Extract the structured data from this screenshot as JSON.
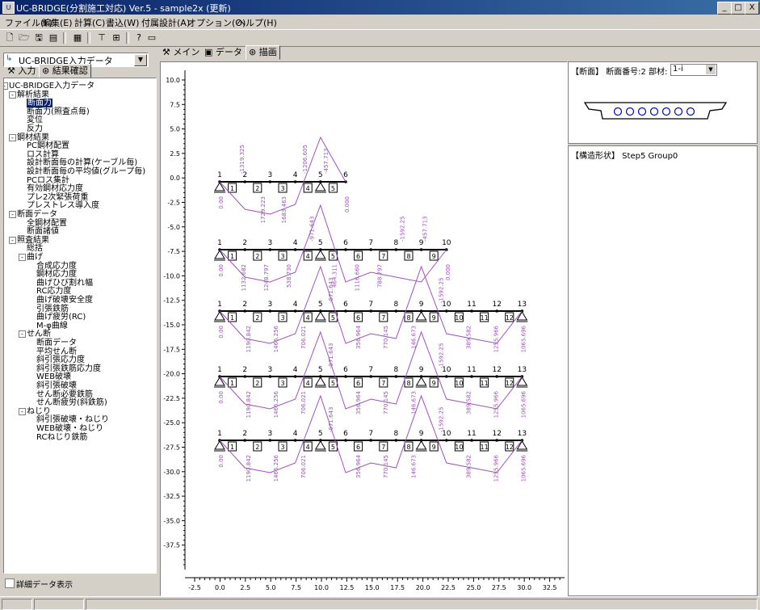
{
  "window": {
    "title": "UC-BRIDGE(分割施工対応) Ver.5 - sample2x (更新)",
    "buttons": [
      "_",
      "□",
      "X"
    ]
  },
  "menu": [
    "ファイル(F)",
    "編集(E)",
    "計算(C)",
    "書込(W)",
    "付属設計(A)",
    "オプション(O)",
    "ヘルプ(H)"
  ],
  "toolbar": [
    "new-icon",
    "open-icon",
    "save-icon",
    "print-icon",
    "calc-icon",
    "tool1-icon",
    "tool2-icon",
    "help-icon",
    "info-icon"
  ],
  "left": {
    "combo_value": "UC-BRIDGE入力データ",
    "tab_input": "入力",
    "tab_result": "結果確認",
    "checkbox_label": "詳細データ表示",
    "tree": [
      {
        "label": "UC-BRIDGE入力データ",
        "level": 0,
        "box": "-"
      },
      {
        "label": "解析結果",
        "level": 1,
        "box": "-"
      },
      {
        "label": "断面力",
        "level": 2,
        "selected": true
      },
      {
        "label": "断面力(照査点毎)",
        "level": 2
      },
      {
        "label": "変位",
        "level": 2
      },
      {
        "label": "反力",
        "level": 2
      },
      {
        "label": "鋼材結果",
        "level": 1,
        "box": "-"
      },
      {
        "label": "PC鋼材配置",
        "level": 2
      },
      {
        "label": "ロス計算",
        "level": 2
      },
      {
        "label": "設計断面毎の計算(ケーブル毎)",
        "level": 2
      },
      {
        "label": "設計断面毎の平均値(グループ毎)",
        "level": 2
      },
      {
        "label": "PCロス集計",
        "level": 2
      },
      {
        "label": "有効鋼材応力度",
        "level": 2
      },
      {
        "label": "プレ2次緊張荷重",
        "level": 2
      },
      {
        "label": "プレストレス導入度",
        "level": 2
      },
      {
        "label": "断面データ",
        "level": 1,
        "box": "-"
      },
      {
        "label": "全鋼材配置",
        "level": 2
      },
      {
        "label": "断面諸値",
        "level": 2
      },
      {
        "label": "照査結果",
        "level": 1,
        "box": "-"
      },
      {
        "label": "総括",
        "level": 2
      },
      {
        "label": "曲げ",
        "level": 2,
        "box": "-"
      },
      {
        "label": "合成応力度",
        "level": 3
      },
      {
        "label": "鋼材応力度",
        "level": 3
      },
      {
        "label": "曲げひび割れ幅",
        "level": 3
      },
      {
        "label": "RC応力度",
        "level": 3
      },
      {
        "label": "曲げ破壊安全度",
        "level": 3
      },
      {
        "label": "引張鉄筋",
        "level": 3
      },
      {
        "label": "曲げ疲労(RC)",
        "level": 3
      },
      {
        "label": "M-φ曲線",
        "level": 3
      },
      {
        "label": "せん断",
        "level": 2,
        "box": "-"
      },
      {
        "label": "断面データ",
        "level": 3
      },
      {
        "label": "平均せん断",
        "level": 3
      },
      {
        "label": "斜引張応力度",
        "level": 3
      },
      {
        "label": "斜引張鉄筋応力度",
        "level": 3
      },
      {
        "label": "WEB破壊",
        "level": 3
      },
      {
        "label": "斜引張破壊",
        "level": 3
      },
      {
        "label": "せん断必要鉄筋",
        "level": 3
      },
      {
        "label": "せん断疲労(斜鉄筋)",
        "level": 3
      },
      {
        "label": "ねじり",
        "level": 2,
        "box": "-"
      },
      {
        "label": "斜引張破壊・ねじり",
        "level": 3
      },
      {
        "label": "WEB破壊・ねじり",
        "level": 3
      },
      {
        "label": "RCねじり鉄筋",
        "level": 3
      }
    ]
  },
  "center": {
    "tabs": [
      "メイン",
      "データ",
      "描画"
    ],
    "active_tab": 2,
    "y_ticks": [
      "10.0",
      "7.5",
      "5.0",
      "2.5",
      "0.0",
      "-2.5",
      "-5.0",
      "-7.5",
      "-10.0",
      "-12.5",
      "-15.0",
      "-17.5",
      "-20.0",
      "-22.5",
      "-25.0",
      "-27.5",
      "-30.0",
      "-32.5",
      "-35.0",
      "-37.5"
    ],
    "x_ticks": [
      "-2.5",
      "0.0",
      "2.5",
      "5.0",
      "7.5",
      "10.0",
      "12.5",
      "15.0",
      "17.5",
      "20.0",
      "22.5",
      "25.0",
      "27.5",
      "30.0",
      "32.5"
    ],
    "beams": [
      {
        "nodes": 6,
        "supports": [
          1,
          5
        ],
        "members": 5,
        "value_labels": [
          "0.00",
          "-1319.325",
          "1729.223",
          "1683.463",
          "-1206.605",
          "-457.713",
          "0.000"
        ]
      },
      {
        "nodes": 10,
        "supports": [
          1,
          5
        ],
        "members": 9,
        "value_labels": [
          "0.00",
          "1132.682",
          "1248.797",
          "538.730",
          "-971.643",
          "464.311",
          "1116.660",
          "788.797",
          "-1592.25",
          "-457.713",
          "0.000"
        ]
      },
      {
        "nodes": 13,
        "supports": [
          1,
          5,
          9,
          13
        ],
        "members": 12,
        "value_labels": [
          "0.00",
          "1190.842",
          "1466.256",
          "706.021",
          "-971.643",
          "356.964",
          "770.145",
          "146.673",
          "-1592.25",
          "389.582",
          "1255.966",
          "1065.696"
        ]
      },
      {
        "nodes": 13,
        "supports": [
          1,
          5,
          9,
          13
        ],
        "members": 12,
        "value_labels": [
          "0.00",
          "1190.842",
          "1466.256",
          "706.021",
          "-971.643",
          "356.964",
          "770.145",
          "146.673",
          "-1592.25",
          "389.582",
          "1255.966",
          "1065.696"
        ]
      },
      {
        "nodes": 13,
        "supports": [
          1,
          5,
          9,
          13
        ],
        "members": 12,
        "value_labels": [
          "0.00",
          "1190.842",
          "1466.256",
          "706.021",
          "-971.643",
          "356.964",
          "770.145",
          "146.673",
          "-1592.25",
          "389.582",
          "1255.966",
          "1065.696"
        ]
      }
    ]
  },
  "right": {
    "section_header": "【断面】 断面番号:2",
    "member_label": "部材:",
    "member_value": "1-i",
    "shape_header": "【構造形状】 Step5 Group0"
  }
}
